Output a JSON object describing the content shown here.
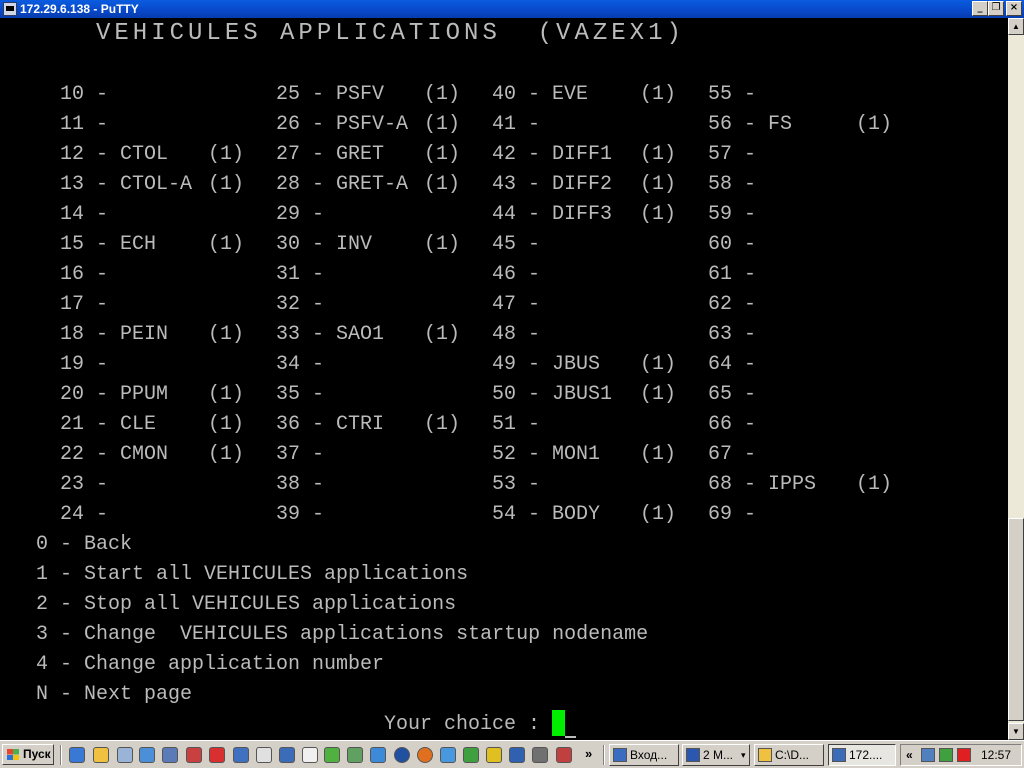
{
  "window": {
    "title": "172.29.6.138 - PuTTY",
    "minimize_glyph": "_",
    "maximize_glyph": "❐",
    "close_glyph": "×"
  },
  "terminal": {
    "header": "VEHICULES APPLICATIONS  (VAZEX1)",
    "apps": [
      {
        "num": "10",
        "name": "",
        "flag": ""
      },
      {
        "num": "11",
        "name": "",
        "flag": ""
      },
      {
        "num": "12",
        "name": "CTOL",
        "flag": "(1)"
      },
      {
        "num": "13",
        "name": "CTOL-A",
        "flag": "(1)"
      },
      {
        "num": "14",
        "name": "",
        "flag": ""
      },
      {
        "num": "15",
        "name": "ECH",
        "flag": "(1)"
      },
      {
        "num": "16",
        "name": "",
        "flag": ""
      },
      {
        "num": "17",
        "name": "",
        "flag": ""
      },
      {
        "num": "18",
        "name": "PEIN",
        "flag": "(1)"
      },
      {
        "num": "19",
        "name": "",
        "flag": ""
      },
      {
        "num": "20",
        "name": "PPUM",
        "flag": "(1)"
      },
      {
        "num": "21",
        "name": "CLE",
        "flag": "(1)"
      },
      {
        "num": "22",
        "name": "CMON",
        "flag": "(1)"
      },
      {
        "num": "23",
        "name": "",
        "flag": ""
      },
      {
        "num": "24",
        "name": "",
        "flag": ""
      },
      {
        "num": "25",
        "name": "PSFV",
        "flag": "(1)"
      },
      {
        "num": "26",
        "name": "PSFV-A",
        "flag": "(1)"
      },
      {
        "num": "27",
        "name": "GRET",
        "flag": "(1)"
      },
      {
        "num": "28",
        "name": "GRET-A",
        "flag": "(1)"
      },
      {
        "num": "29",
        "name": "",
        "flag": ""
      },
      {
        "num": "30",
        "name": "INV",
        "flag": "(1)"
      },
      {
        "num": "31",
        "name": "",
        "flag": ""
      },
      {
        "num": "32",
        "name": "",
        "flag": ""
      },
      {
        "num": "33",
        "name": "SAO1",
        "flag": "(1)"
      },
      {
        "num": "34",
        "name": "",
        "flag": ""
      },
      {
        "num": "35",
        "name": "",
        "flag": ""
      },
      {
        "num": "36",
        "name": "CTRI",
        "flag": "(1)"
      },
      {
        "num": "37",
        "name": "",
        "flag": ""
      },
      {
        "num": "38",
        "name": "",
        "flag": ""
      },
      {
        "num": "39",
        "name": "",
        "flag": ""
      },
      {
        "num": "40",
        "name": "EVE",
        "flag": "(1)"
      },
      {
        "num": "41",
        "name": "",
        "flag": ""
      },
      {
        "num": "42",
        "name": "DIFF1",
        "flag": "(1)"
      },
      {
        "num": "43",
        "name": "DIFF2",
        "flag": "(1)"
      },
      {
        "num": "44",
        "name": "DIFF3",
        "flag": "(1)"
      },
      {
        "num": "45",
        "name": "",
        "flag": ""
      },
      {
        "num": "46",
        "name": "",
        "flag": ""
      },
      {
        "num": "47",
        "name": "",
        "flag": ""
      },
      {
        "num": "48",
        "name": "",
        "flag": ""
      },
      {
        "num": "49",
        "name": "JBUS",
        "flag": "(1)"
      },
      {
        "num": "50",
        "name": "JBUS1",
        "flag": "(1)"
      },
      {
        "num": "51",
        "name": "",
        "flag": ""
      },
      {
        "num": "52",
        "name": "MON1",
        "flag": "(1)"
      },
      {
        "num": "53",
        "name": "",
        "flag": ""
      },
      {
        "num": "54",
        "name": "BODY",
        "flag": "(1)"
      },
      {
        "num": "55",
        "name": "",
        "flag": ""
      },
      {
        "num": "56",
        "name": "FS",
        "flag": "(1)"
      },
      {
        "num": "57",
        "name": "",
        "flag": ""
      },
      {
        "num": "58",
        "name": "",
        "flag": ""
      },
      {
        "num": "59",
        "name": "",
        "flag": ""
      },
      {
        "num": "60",
        "name": "",
        "flag": ""
      },
      {
        "num": "61",
        "name": "",
        "flag": ""
      },
      {
        "num": "62",
        "name": "",
        "flag": ""
      },
      {
        "num": "63",
        "name": "",
        "flag": ""
      },
      {
        "num": "64",
        "name": "",
        "flag": ""
      },
      {
        "num": "65",
        "name": "",
        "flag": ""
      },
      {
        "num": "66",
        "name": "",
        "flag": ""
      },
      {
        "num": "67",
        "name": "",
        "flag": ""
      },
      {
        "num": "68",
        "name": "IPPS",
        "flag": "(1)"
      },
      {
        "num": "69",
        "name": "",
        "flag": ""
      }
    ],
    "options": [
      "0 - Back",
      "1 - Start all VEHICULES applications",
      "2 - Stop all VEHICULES applications",
      "3 - Change  VEHICULES applications startup nodename",
      "4 - Change application number",
      "N - Next page"
    ],
    "prompt": "Your choice : ",
    "cursor_color": "#00ee00",
    "text_color": "#bbbbbb"
  },
  "scrollbar": {
    "up_glyph": "▲",
    "down_glyph": "▼"
  },
  "taskbar": {
    "start_label": "Пуск",
    "overflow_glyph": "»",
    "items": [
      {
        "label": "Вход...",
        "icon": "outlook-icon",
        "active": false
      },
      {
        "label": "2 M...",
        "icon": "word-icon",
        "active": false
      },
      {
        "label": "C:\\D...",
        "icon": "folder-icon",
        "active": false
      },
      {
        "label": "172....",
        "icon": "putty-icon",
        "active": true
      }
    ],
    "tray_chevron": "«",
    "clock": "12:57"
  }
}
